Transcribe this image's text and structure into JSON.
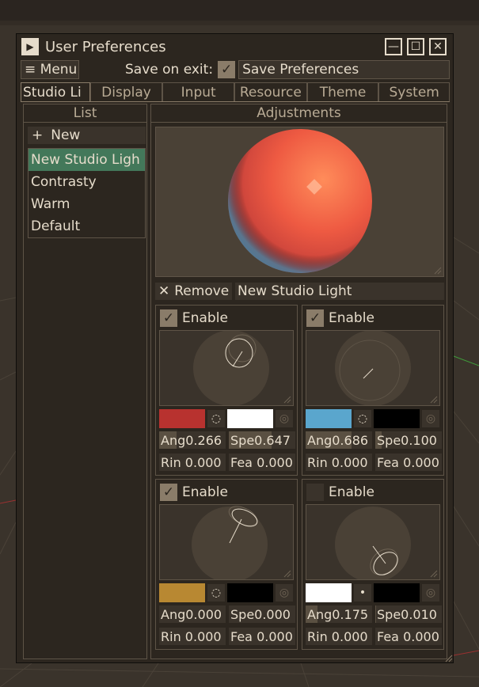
{
  "window": {
    "title": "User Preferences"
  },
  "menubar": {
    "menu_label": "≡ Menu",
    "save_on_exit_label": "Save on exit:",
    "save_on_exit_checked": true,
    "save_button": "Save Preferences"
  },
  "tabs": [
    "Studio Li",
    "Display",
    "Input",
    "Resource",
    "Theme",
    "System"
  ],
  "list": {
    "header": "List",
    "new_button": "New",
    "items": [
      "New Studio Ligh",
      "Contrasty",
      "Warm",
      "Default"
    ],
    "selected_index": 0
  },
  "adjustments": {
    "header": "Adjustments",
    "remove_button": "Remove",
    "name_value": "New Studio Light",
    "lights": [
      {
        "enable_label": "Enable",
        "enabled": true,
        "diffuse_color": "#b8322f",
        "specular_color": "#ffffff",
        "angle_label": "Ang",
        "angle": "0.266",
        "angle_fill": 0.266,
        "spec_label": "Spe",
        "spec": "0.647",
        "spec_fill": 0.647,
        "rim_label": "Rin",
        "rim": "0.000",
        "feather_label": "Fea",
        "feather": "0.000"
      },
      {
        "enable_label": "Enable",
        "enabled": true,
        "diffuse_color": "#5aa6cd",
        "specular_color": "#000000",
        "angle_label": "Ang",
        "angle": "0.686",
        "angle_fill": 0.686,
        "spec_label": "Spe",
        "spec": "0.100",
        "spec_fill": 0.1,
        "rim_label": "Rin",
        "rim": "0.000",
        "feather_label": "Fea",
        "feather": "0.000"
      },
      {
        "enable_label": "Enable",
        "enabled": true,
        "diffuse_color": "#b88832",
        "specular_color": "#000000",
        "angle_label": "Ang",
        "angle": "0.000",
        "angle_fill": 0.0,
        "spec_label": "Spe",
        "spec": "0.000",
        "spec_fill": 0.0,
        "rim_label": "Rin",
        "rim": "0.000",
        "feather_label": "Fea",
        "feather": "0.000"
      },
      {
        "enable_label": "Enable",
        "enabled": false,
        "diffuse_color": "#ffffff",
        "specular_color": "#000000",
        "angle_label": "Ang",
        "angle": "0.175",
        "angle_fill": 0.175,
        "spec_label": "Spe",
        "spec": "0.010",
        "spec_fill": 0.01,
        "rim_label": "Rin",
        "rim": "0.000",
        "feather_label": "Fea",
        "feather": "0.000"
      }
    ]
  },
  "icons": {
    "collapse": "play-triangle-icon",
    "minimize": "minimize-icon",
    "maximize": "maximize-icon",
    "close": "close-icon",
    "new": "plus-icon",
    "remove": "x-icon",
    "diffuse_mode": "refresh-ring-icon",
    "specular_mode": "ring-icon"
  }
}
